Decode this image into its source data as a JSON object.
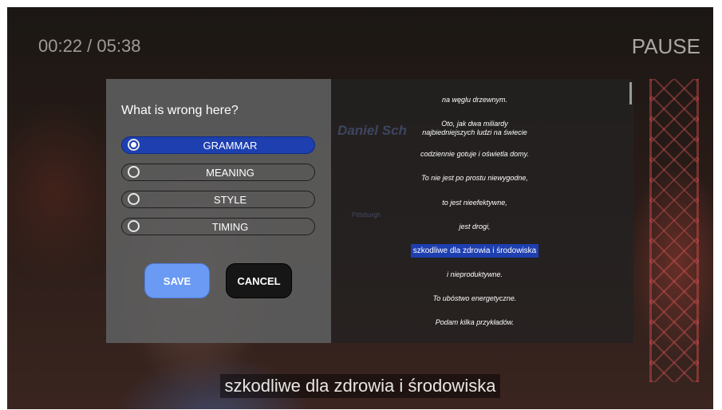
{
  "player": {
    "time": "00:22 / 05:38",
    "pause_label": "PAUSE",
    "subtitle": "szkodliwe dla zdrowia i środowiska"
  },
  "dialog": {
    "title": "What is wrong here?",
    "options": [
      {
        "label": "GRAMMAR",
        "selected": true
      },
      {
        "label": "MEANING",
        "selected": false
      },
      {
        "label": "STYLE",
        "selected": false
      },
      {
        "label": "TIMING",
        "selected": false
      }
    ],
    "save_label": "SAVE",
    "cancel_label": "CANCEL"
  },
  "transcript": {
    "lines": [
      "na węglu drzewnym.",
      "Oto, jak dwa miliardy\nnajbiedniejszych ludzi na świecie",
      "codziennie gotuje i oświetla domy.",
      "To nie jest po prostu niewygodne,",
      "to jest nieefektywne,",
      "jest drogi,",
      "szkodliwe dla zdrowia i środowiska",
      "i nieproduktywne.",
      "To ubóstwo energetyczne.",
      "Podam kilka przykładów."
    ],
    "active_index": 6
  },
  "colors": {
    "accent": "#1d3fb0",
    "save_button": "#6a9af3",
    "cancel_button": "#161616"
  }
}
